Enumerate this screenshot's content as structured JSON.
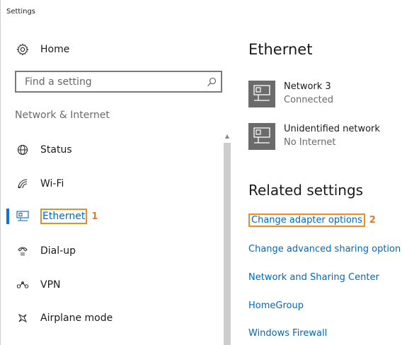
{
  "window": {
    "title": "Settings"
  },
  "sidebar": {
    "home_label": "Home",
    "search_placeholder": "Find a setting",
    "section_label": "Network & Internet",
    "items": [
      {
        "label": "Status",
        "icon": "globe-icon"
      },
      {
        "label": "Wi-Fi",
        "icon": "wifi-icon"
      },
      {
        "label": "Ethernet",
        "icon": "ethernet-icon",
        "selected": true,
        "callout": "1"
      },
      {
        "label": "Dial-up",
        "icon": "dialup-icon"
      },
      {
        "label": "VPN",
        "icon": "vpn-icon"
      },
      {
        "label": "Airplane mode",
        "icon": "airplane-icon"
      }
    ]
  },
  "main": {
    "title": "Ethernet",
    "networks": [
      {
        "name": "Network  3",
        "status": "Connected"
      },
      {
        "name": "Unidentified network",
        "status": "No Internet"
      }
    ],
    "related_title": "Related settings",
    "links": [
      {
        "label": "Change adapter options",
        "callout": "2"
      },
      {
        "label": "Change advanced sharing option"
      },
      {
        "label": "Network and Sharing Center"
      },
      {
        "label": "HomeGroup"
      },
      {
        "label": "Windows Firewall"
      }
    ]
  },
  "colors": {
    "accent": "#0078d7",
    "link": "#0067c0",
    "highlight": "#f08a24",
    "network_icon_bg": "#6b6b6b"
  }
}
